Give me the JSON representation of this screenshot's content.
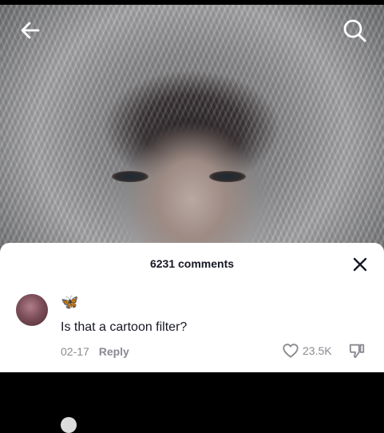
{
  "header": {
    "back_icon": "arrow-left-icon",
    "search_icon": "search-icon"
  },
  "comments_sheet": {
    "title": "6231 comments",
    "close_icon": "close-icon",
    "comment": {
      "username": "🦋",
      "text": "Is that a cartoon filter?",
      "date": "02-17",
      "reply_label": "Reply",
      "likes": "23.5K",
      "like_icon": "heart-outline-icon",
      "dislike_icon": "thumbs-down-icon"
    }
  },
  "colors": {
    "text_primary": "#161823",
    "text_secondary": "#8a8b91",
    "sheet_bg": "#ffffff"
  }
}
